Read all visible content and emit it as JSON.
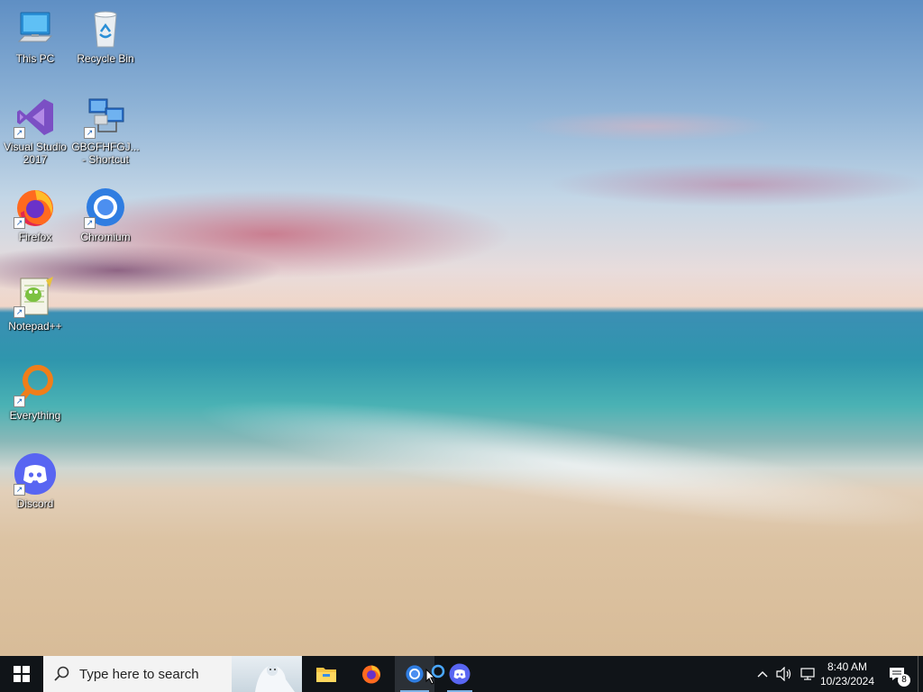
{
  "desktop": {
    "icons": [
      {
        "label": "This PC",
        "icon": "computer-icon"
      },
      {
        "label": "Recycle Bin",
        "icon": "recycle-bin-icon"
      },
      {
        "label": "Visual Studio 2017",
        "icon": "visual-studio-icon"
      },
      {
        "label": "GBGFHFGJ... - Shortcut",
        "icon": "network-computer-icon"
      },
      {
        "label": "Firefox",
        "icon": "firefox-icon"
      },
      {
        "label": "Chromium",
        "icon": "chromium-icon"
      },
      {
        "label": "Notepad++",
        "icon": "notepadpp-icon"
      },
      {
        "label": "Everything",
        "icon": "everything-icon"
      },
      {
        "label": "Discord",
        "icon": "discord-icon"
      }
    ]
  },
  "taskbar": {
    "search_placeholder": "Type here to search",
    "pinned": [
      {
        "name": "File Explorer",
        "icon": "folder-icon"
      },
      {
        "name": "Firefox",
        "icon": "firefox-icon"
      },
      {
        "name": "Chromium",
        "icon": "chromium-icon"
      },
      {
        "name": "Cortana",
        "icon": "cortana-icon"
      },
      {
        "name": "Discord",
        "icon": "discord-icon"
      }
    ],
    "tray": {
      "time": "8:40 AM",
      "date": "10/23/2024",
      "notification_count": "8"
    }
  },
  "colors": {
    "taskbar_bg": "#101418",
    "search_bg": "#f3f3f3",
    "active_underline": "#7fb3e6"
  }
}
